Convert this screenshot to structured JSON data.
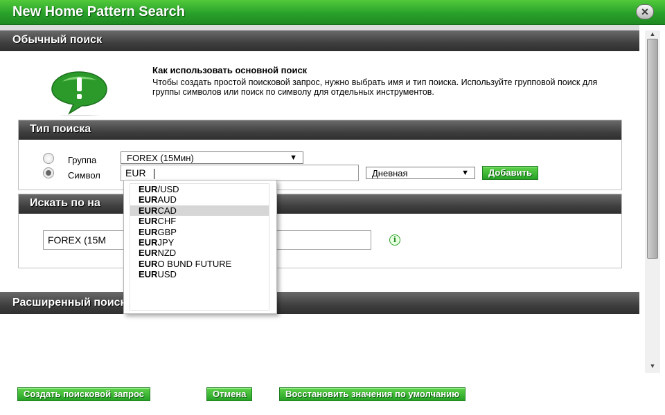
{
  "window": {
    "title": "New Home Pattern Search",
    "close_label": "✕"
  },
  "basic": {
    "section_title": "Обычный поиск",
    "info_title": "Как использовать основной поиск",
    "info_text": "Чтобы создать простой поисковой запрос, нужно выбрать имя и тип поиска. Используйте групповой поиск для группы символов или поиск по символу для отдельных инструментов."
  },
  "search_type": {
    "panel_title": "Тип поиска",
    "group_label": "Группа",
    "group_selected": "FOREX (15Мин)",
    "symbol_label": "Символ",
    "symbol_value": "EUR",
    "period_selected": "Дневная",
    "add_button": "Добавить",
    "selected_radio": "symbol"
  },
  "autocomplete": {
    "highlighted_index": 2,
    "items": [
      {
        "prefix": "EUR",
        "rest": "/USD"
      },
      {
        "prefix": "EUR",
        "rest": "AUD"
      },
      {
        "prefix": "EUR",
        "rest": "CAD"
      },
      {
        "prefix": "EUR",
        "rest": "CHF"
      },
      {
        "prefix": "EUR",
        "rest": "GBP"
      },
      {
        "prefix": "EUR",
        "rest": "JPY"
      },
      {
        "prefix": "EUR",
        "rest": "NZD"
      },
      {
        "prefix": "EUR",
        "rest": "O BUND FUTURE"
      },
      {
        "prefix": "EUR",
        "rest": "USD"
      }
    ]
  },
  "name_search": {
    "panel_title": "Искать по на",
    "input_value": "FOREX (15M"
  },
  "advanced": {
    "section_title": "Расширенный поиск"
  },
  "footer": {
    "create": "Создать поисковой запрос",
    "cancel": "Отмена",
    "restore": "Восстановить значения по умолчанию"
  },
  "colors": {
    "accent_green": "#29a12a",
    "header_dark": "#3f3f3f"
  },
  "icons": {
    "info_big": "green-speech-bubble-exclamation-icon",
    "info_small": "info-circle-icon"
  }
}
